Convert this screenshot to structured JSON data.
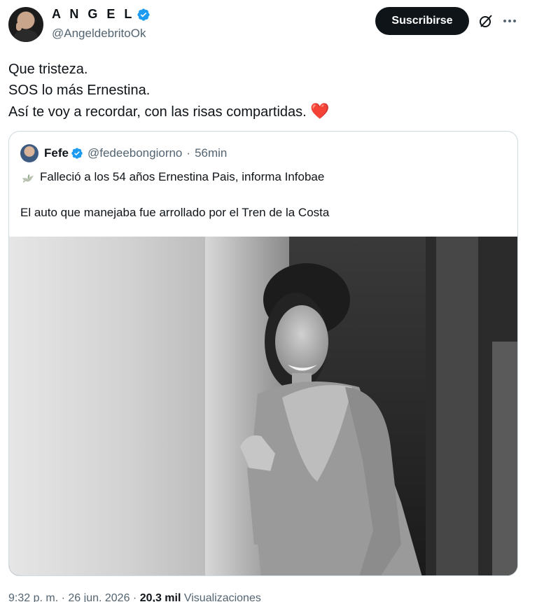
{
  "author": {
    "name": "A N G E L",
    "handle": "@AngeldebritoOk"
  },
  "actions": {
    "subscribe_label": "Suscribirse"
  },
  "tweet": {
    "lines": [
      "Que tristeza.",
      "SOS lo más Ernestina.",
      "Así te voy a recordar, con las risas compartidas."
    ],
    "emoji": "❤️"
  },
  "quoted": {
    "name": "Fefe",
    "handle": "@fedeebongiorno",
    "separator": "·",
    "time": "56min",
    "line1": "Falleció a los 54 años Ernestina Pais, informa Infobae",
    "line2": "El auto que manejaba fue arrollado por el Tren de la Costa"
  },
  "meta": {
    "time": "9:32 p. m.",
    "sep1": "·",
    "date": "26 jun. 2026",
    "sep2": "·",
    "views_count": "20,3 mil",
    "views_label": "Visualizaciones"
  },
  "colors": {
    "verified": "#1d9bf0",
    "text": "#0f1419",
    "secondary": "#536471",
    "border": "#cfd9de",
    "heart": "#e0245e"
  },
  "icons": {
    "verified": "verified-badge-icon",
    "grok": "grok-icon",
    "more": "more-options-icon",
    "dove": "dove-emoji-icon"
  }
}
